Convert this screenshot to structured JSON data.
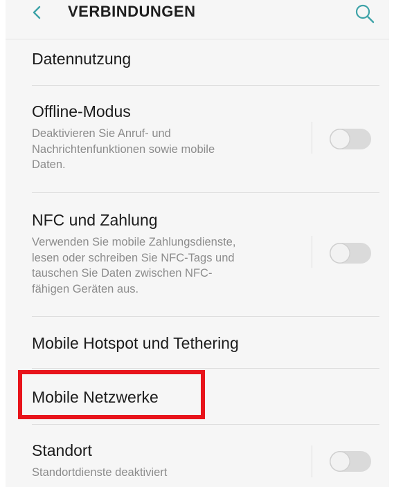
{
  "header": {
    "title": "VERBINDUNGEN",
    "back_icon": "chevron-left-icon",
    "search_icon": "search-icon"
  },
  "items": [
    {
      "title": "Datennutzung"
    },
    {
      "title": "Offline-Modus",
      "description_lines": [
        "Deaktivieren Sie Anruf- und",
        "Nachrichtenfunktionen sowie mobile",
        "Daten."
      ],
      "toggle_on": false
    },
    {
      "title": "NFC und Zahlung",
      "description_lines": [
        "Verwenden Sie mobile Zahlungsdienste,",
        "lesen oder schreiben Sie NFC-Tags und",
        "tauschen Sie Daten zwischen NFC-",
        "fähigen Geräten aus."
      ],
      "toggle_on": false
    },
    {
      "title": "Mobile Hotspot und Tethering"
    },
    {
      "title": "Mobile Netzwerke",
      "highlighted": true
    },
    {
      "title": "Standort",
      "description_lines": [
        "Standortdienste deaktiviert"
      ],
      "toggle_on": false
    }
  ],
  "watermark": "",
  "colors": {
    "accent": "#3ea3a8",
    "highlight": "#e8141b",
    "background": "#f6f6f6",
    "toggle_off": "#dadada"
  }
}
